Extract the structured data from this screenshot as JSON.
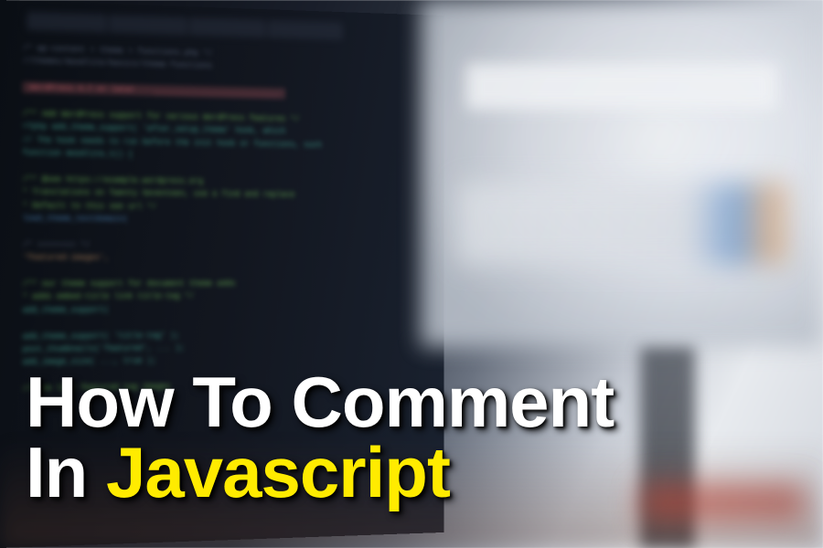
{
  "headline": {
    "line1": "How To Comment",
    "line2_part1": "In ",
    "line2_part2": "Javascript"
  },
  "code_lines": [
    {
      "cls": "c-gray",
      "txt": "/* wp-content > theme > functions.php */"
    },
    {
      "cls": "c-gray",
      "txt": "//themes/moodlite/basics/theme-functions"
    },
    {
      "cls": "c-white",
      "txt": ""
    },
    {
      "cls": "c-red",
      "txt": " WordPress 4.7 or later "
    },
    {
      "cls": "c-red",
      "txt": " ___________________________ "
    },
    {
      "cls": "c-white",
      "txt": ""
    },
    {
      "cls": "c-green",
      "txt": "/** Add WordPress support for various WordPress features */"
    },
    {
      "cls": "c-teal",
      "txt": "<?php add_theme_support( 'after_setup_theme' hook, which"
    },
    {
      "cls": "c-teal",
      "txt": "// The hook needs to run before the init hook or functions, such"
    },
    {
      "cls": "c-teal",
      "txt": "function moodlite_t() {"
    },
    {
      "cls": "c-white",
      "txt": ""
    },
    {
      "cls": "c-green",
      "txt": "/** @see https://example.wordpress.org"
    },
    {
      "cls": "c-green",
      "txt": " * Translations on Twenty Seventeen, use a find and replace"
    },
    {
      "cls": "c-green",
      "txt": " * Default to this see url */"
    },
    {
      "cls": "c-blue",
      "txt": "load_theme_textdomain("
    },
    {
      "cls": "c-white",
      "txt": ""
    },
    {
      "cls": "c-gray",
      "txt": "    /* ======== */"
    },
    {
      "cls": "c-orange",
      "txt": "    'featured-images',"
    },
    {
      "cls": "c-white",
      "txt": ""
    },
    {
      "cls": "c-green",
      "txt": "/** our theme support for document  theme adds"
    },
    {
      "cls": "c-green",
      "txt": " * adds embed-title link title-tag */"
    },
    {
      "cls": "c-teal",
      "txt": "add_theme_support("
    },
    {
      "cls": "c-white",
      "txt": ""
    },
    {
      "cls": "c-teal",
      "txt": "    add_theme_support( 'title-tag' );"
    },
    {
      "cls": "c-teal",
      "txt": "    post_thumbnails('featured', ... );"
    },
    {
      "cls": "c-teal",
      "txt": "    add_image_size( ..., true );"
    },
    {
      "cls": "c-white",
      "txt": ""
    },
    {
      "cls": "c-green",
      "txt": "    // see link featured tag images"
    }
  ]
}
